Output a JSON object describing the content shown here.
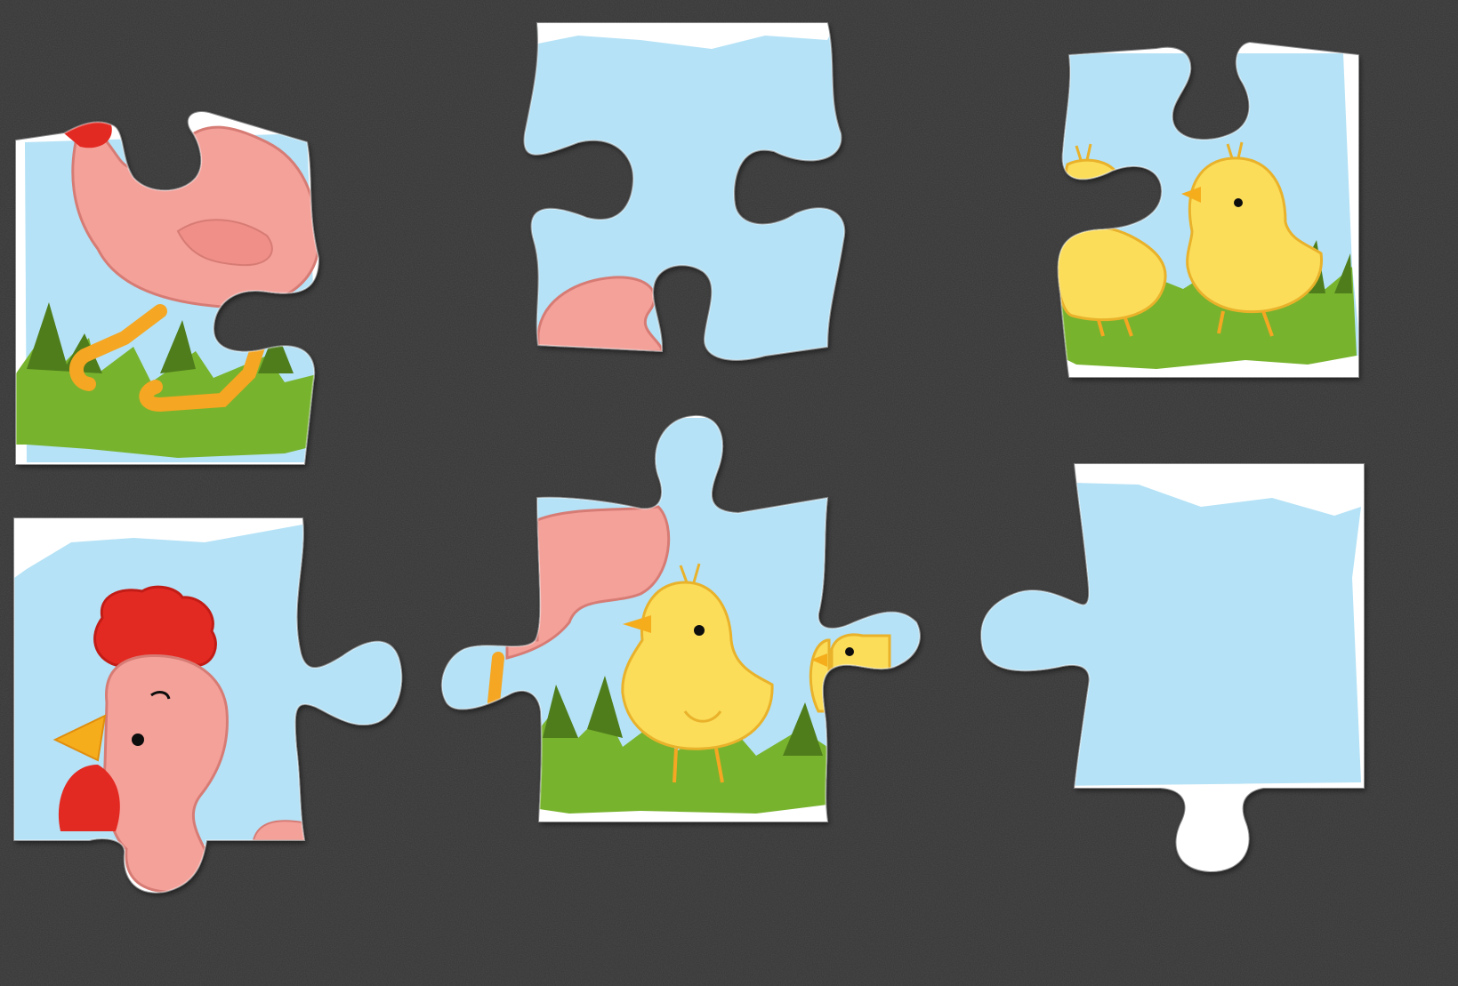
{
  "app": {
    "name": "",
    "screen": "jigsaw-puzzle-board"
  },
  "theme": {
    "table": "#353535",
    "table_dark": "#262626",
    "sky": "#b5e2f6",
    "cloud": "#ffffff",
    "grass": "#78b32e",
    "grass_dark": "#4f7d1c",
    "hen_pink": "#f4a19a",
    "hen_outline": "#d77b74",
    "comb_red": "#e32b24",
    "beak_orange": "#f6ad1d",
    "chick_yellow": "#fbdd5a",
    "chick_outline": "#e9b22b",
    "legs_orange": "#f5a623",
    "eye": "#111111"
  },
  "puzzle": {
    "picture": "hen-and-chicks",
    "pieces": [
      {
        "id": "piece-hen-body",
        "content": "hen-body",
        "placed": false
      },
      {
        "id": "piece-top-sky",
        "content": "sky-with-hen-tail",
        "placed": false
      },
      {
        "id": "piece-chicks-right",
        "content": "two-chicks",
        "placed": false
      },
      {
        "id": "piece-rooster-head",
        "content": "hen-head",
        "placed": false
      },
      {
        "id": "piece-center-chick",
        "content": "chick-on-grass",
        "placed": false
      },
      {
        "id": "piece-empty-sky",
        "content": "sky",
        "placed": false
      }
    ]
  }
}
